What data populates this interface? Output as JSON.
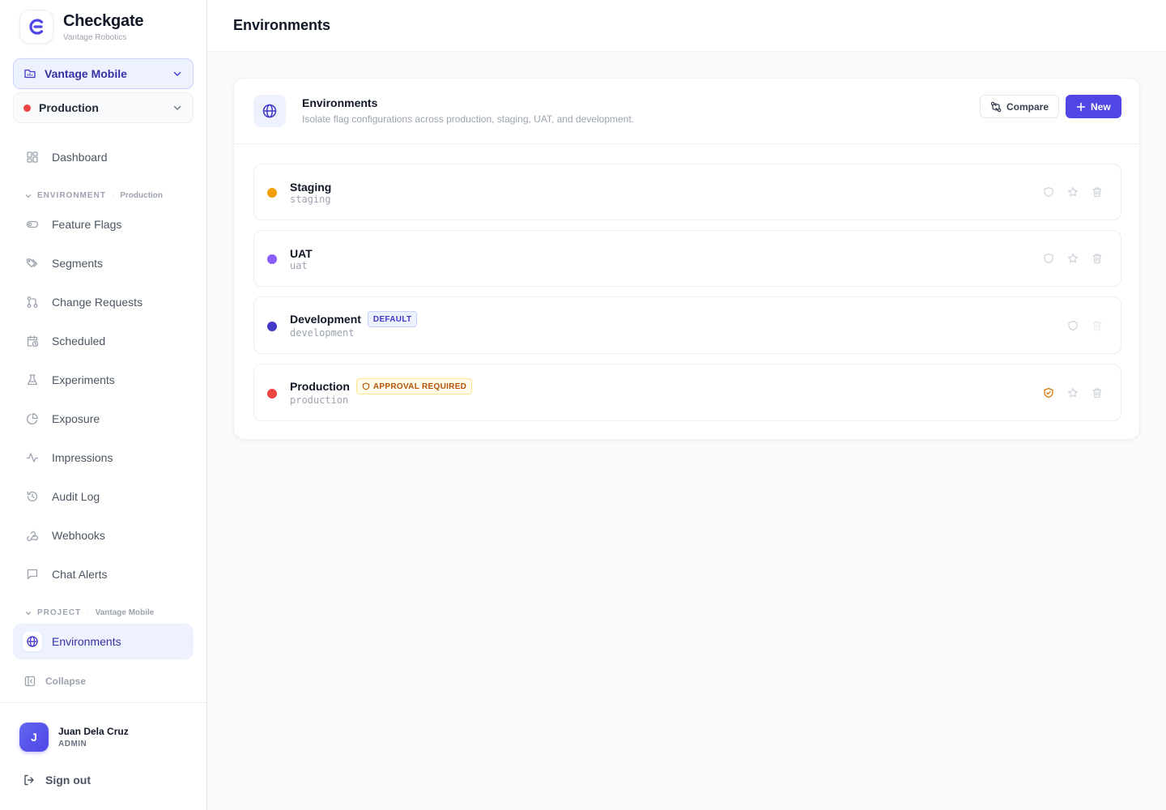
{
  "app": {
    "name": "Checkgate",
    "org": "Vantage Robotics"
  },
  "project_selector": {
    "value": "Vantage Mobile"
  },
  "env_selector": {
    "value": "Production",
    "color": "#ef4444"
  },
  "nav": {
    "dashboard": "Dashboard",
    "environment_section": {
      "title": "ENVIRONMENT",
      "context": "Production"
    },
    "environment_items": [
      {
        "label": "Feature Flags",
        "icon": "toggle-icon"
      },
      {
        "label": "Segments",
        "icon": "tags-icon"
      },
      {
        "label": "Change Requests",
        "icon": "git-pull-request-icon"
      },
      {
        "label": "Scheduled",
        "icon": "calendar-clock-icon"
      },
      {
        "label": "Experiments",
        "icon": "flask-icon"
      },
      {
        "label": "Exposure",
        "icon": "pie-chart-icon"
      },
      {
        "label": "Impressions",
        "icon": "activity-icon"
      },
      {
        "label": "Audit Log",
        "icon": "history-icon"
      },
      {
        "label": "Webhooks",
        "icon": "webhook-icon"
      },
      {
        "label": "Chat Alerts",
        "icon": "message-square-icon"
      }
    ],
    "project_section": {
      "title": "PROJECT",
      "context": "Vantage Mobile"
    },
    "project_items": [
      {
        "label": "Environments",
        "icon": "globe-icon",
        "active": true
      }
    ],
    "collapse": "Collapse"
  },
  "user": {
    "initial": "J",
    "name": "Juan Dela Cruz",
    "role": "ADMIN",
    "signout": "Sign out"
  },
  "page": {
    "title": "Environments"
  },
  "card": {
    "title": "Environments",
    "description": "Isolate flag configurations across production, staging, UAT, and development.",
    "compare_label": "Compare",
    "new_label": "New"
  },
  "environments": [
    {
      "name": "Staging",
      "key": "staging",
      "color": "#f59e0b",
      "badge": "",
      "actions": "shield,star,trash"
    },
    {
      "name": "UAT",
      "key": "uat",
      "color": "#8b5cf6",
      "badge": "",
      "actions": "shield,star,trash"
    },
    {
      "name": "Development",
      "key": "development",
      "color": "#4338ca",
      "badge": "DEFAULT",
      "actions": "shield,trash-disabled"
    },
    {
      "name": "Production",
      "key": "production",
      "color": "#ef4444",
      "badge": "APPROVAL REQUIRED",
      "actions": "shield-active,star,trash"
    }
  ],
  "colors": {
    "accent": "#4f46e5",
    "accent_soft": "#eef2ff",
    "warning": "#d97706"
  }
}
